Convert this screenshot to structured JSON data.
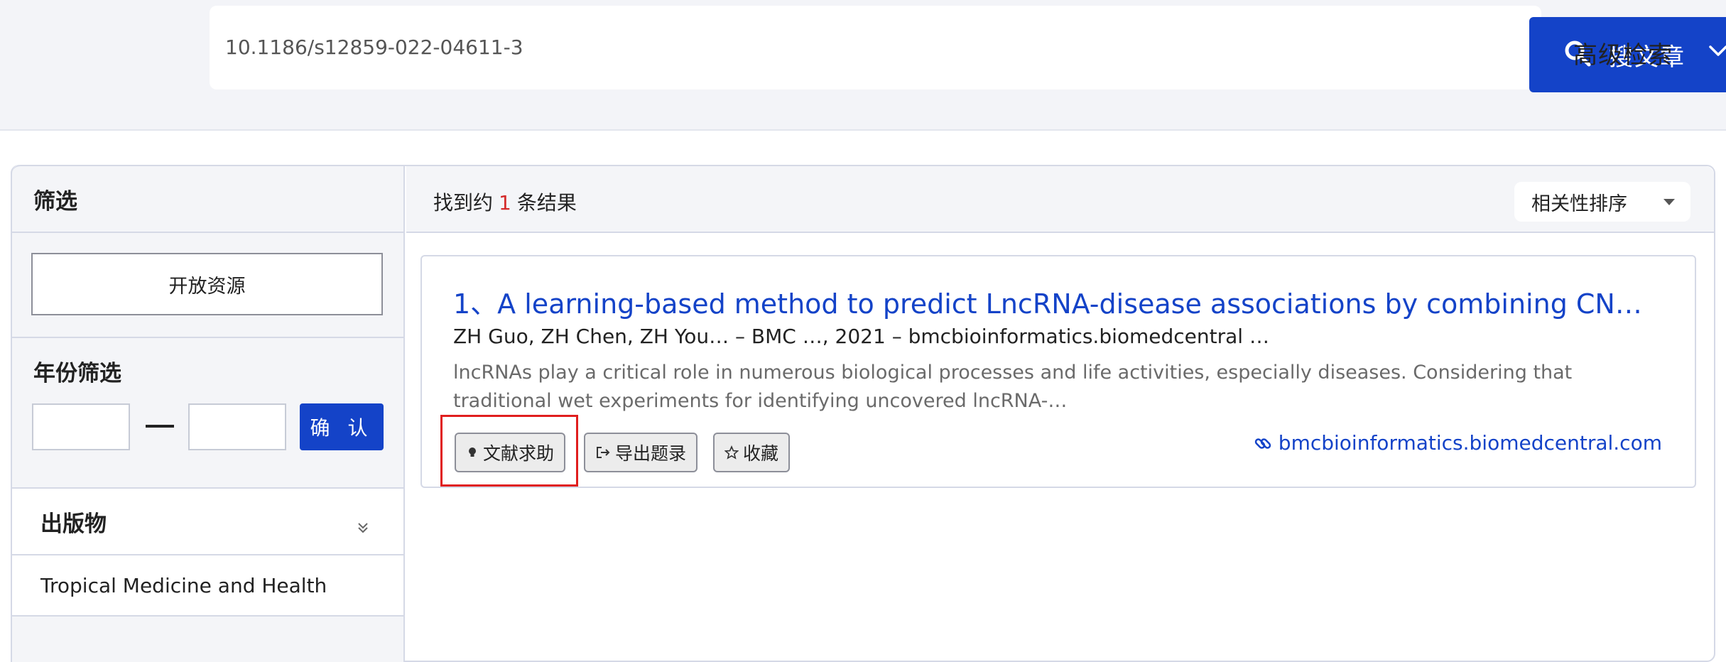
{
  "search": {
    "query": "10.1186/s12859-022-04611-3",
    "button_label": "搜文章",
    "advanced_label": "高级检索"
  },
  "sidebar": {
    "title": "筛选",
    "open_resources": "开放资源",
    "year_filter_title": "年份筛选",
    "year_from": "",
    "year_to": "",
    "confirm_label": "确 认",
    "publications_title": "出版物",
    "publications": [
      "Tropical Medicine and Health"
    ]
  },
  "results": {
    "count_prefix": "找到约",
    "count": "1",
    "count_suffix": "条结果",
    "sort_label": "相关性排序",
    "items": [
      {
        "title": "1、A learning-based method to predict LncRNA-disease associations by combining CNN...",
        "meta": "ZH Guo, ZH Chen, ZH You… – BMC …, 2021 – bmcbioinformatics.biomedcentral …",
        "abstract": "lncRNAs play a critical role in numerous biological processes and life activities, especially diseases. Considering that traditional wet experiments for identifying uncovered lncRNA-…",
        "help_label": "文献求助",
        "export_label": "导出题录",
        "favorite_label": "收藏",
        "source": "bmcbioinformatics.biomedcentral.com"
      }
    ]
  },
  "colors": {
    "accent": "#1443c8",
    "highlight": "#e01e1e",
    "count_red": "#d42b2b"
  },
  "icons": [
    "search-icon",
    "chevron-down-icon",
    "double-chevron-down-icon",
    "lightbulb-icon",
    "export-icon",
    "star-icon",
    "link-icon"
  ]
}
